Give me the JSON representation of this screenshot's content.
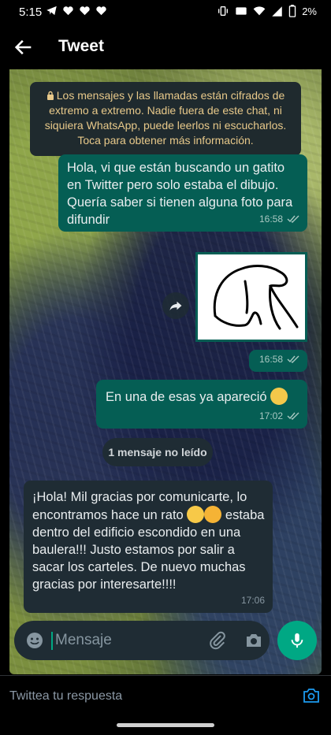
{
  "status_bar": {
    "time": "5:15",
    "battery": "2%"
  },
  "app_bar": {
    "title": "Tweet"
  },
  "chat": {
    "encryption_notice": "Los mensajes y las llamadas están cifrados de extremo a extremo. Nadie fuera de este chat, ni siquiera WhatsApp, puede leerlos ni escucharlos. Toca para obtener más información.",
    "messages": [
      {
        "text": "Hola, vi que están buscando un gatito en Twitter pero solo estaba el dibujo. Quería saber si tienen alguna foto para difundir",
        "time": "16:58"
      },
      {
        "time": "16:58"
      },
      {
        "text": "En una de esas ya apareció",
        "time": "17:02"
      },
      {
        "text_a": "¡Hola! Mil gracias por comunicarte, lo encontramos hace un rato",
        "text_b": "estaba dentro del edificio escondido en una baulera!!! Justo estamos por salir a sacar los carteles. De nuevo muchas gracias por interesarte!!!!",
        "time": "17:06"
      }
    ],
    "unread_label": "1 mensaje no leído",
    "composer_placeholder": "Mensaje"
  },
  "reply": {
    "placeholder": "Twittea tu respuesta"
  },
  "colors": {
    "outgoing": "#055e54",
    "incoming": "#1f2c34",
    "accent": "#00a884"
  }
}
